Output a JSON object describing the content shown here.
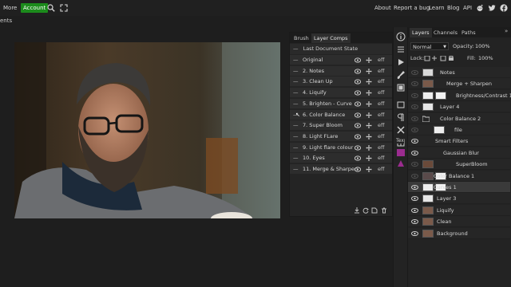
{
  "topbar": {
    "more": "More",
    "account": "Account",
    "links": [
      "About",
      "Report a bug",
      "Learn",
      "Blog",
      "API"
    ]
  },
  "menurow": {
    "fragment": "ents"
  },
  "comps_panel": {
    "tabs": [
      "Brush",
      "Layer Comps"
    ],
    "last_doc": "Last Document State",
    "items": [
      "Original",
      "2. Notes",
      "3. Clean Up",
      "4. Liquify",
      "5. Brighten - Curve",
      "6. Color Balance",
      "7. Super Bloom",
      "8. Light FLare",
      "9. Light flare colour",
      "10. Eyes",
      "11. Merge & Sharpen"
    ],
    "eff": "eff"
  },
  "mid_tools": {
    "tex": "Tex"
  },
  "layers_panel": {
    "tabs": [
      "Layers",
      "Channels",
      "Paths"
    ],
    "blend_mode": "Normal",
    "opacity_label": "Opacity:",
    "opacity_value": "100%",
    "lock_label": "Lock:",
    "fill_label": "Fill:",
    "fill_value": "100%",
    "layers": [
      "Notes",
      "Merge + Sharpen",
      "Brightness/Contrast 1",
      "Layer 4",
      "Color Balance 2",
      "file",
      "Smart Filters",
      "Gaussian Blur",
      "SuperBloom",
      "Color Balance 1",
      "Curves 1",
      "Layer 3",
      "Liquify",
      "Clean",
      "Background"
    ]
  },
  "colors": {
    "accent_green": "#1c8b1c",
    "panel_bg": "#242424",
    "selected_row": "#3a3a3a",
    "swatch_magenta": "#9b2c8f"
  }
}
